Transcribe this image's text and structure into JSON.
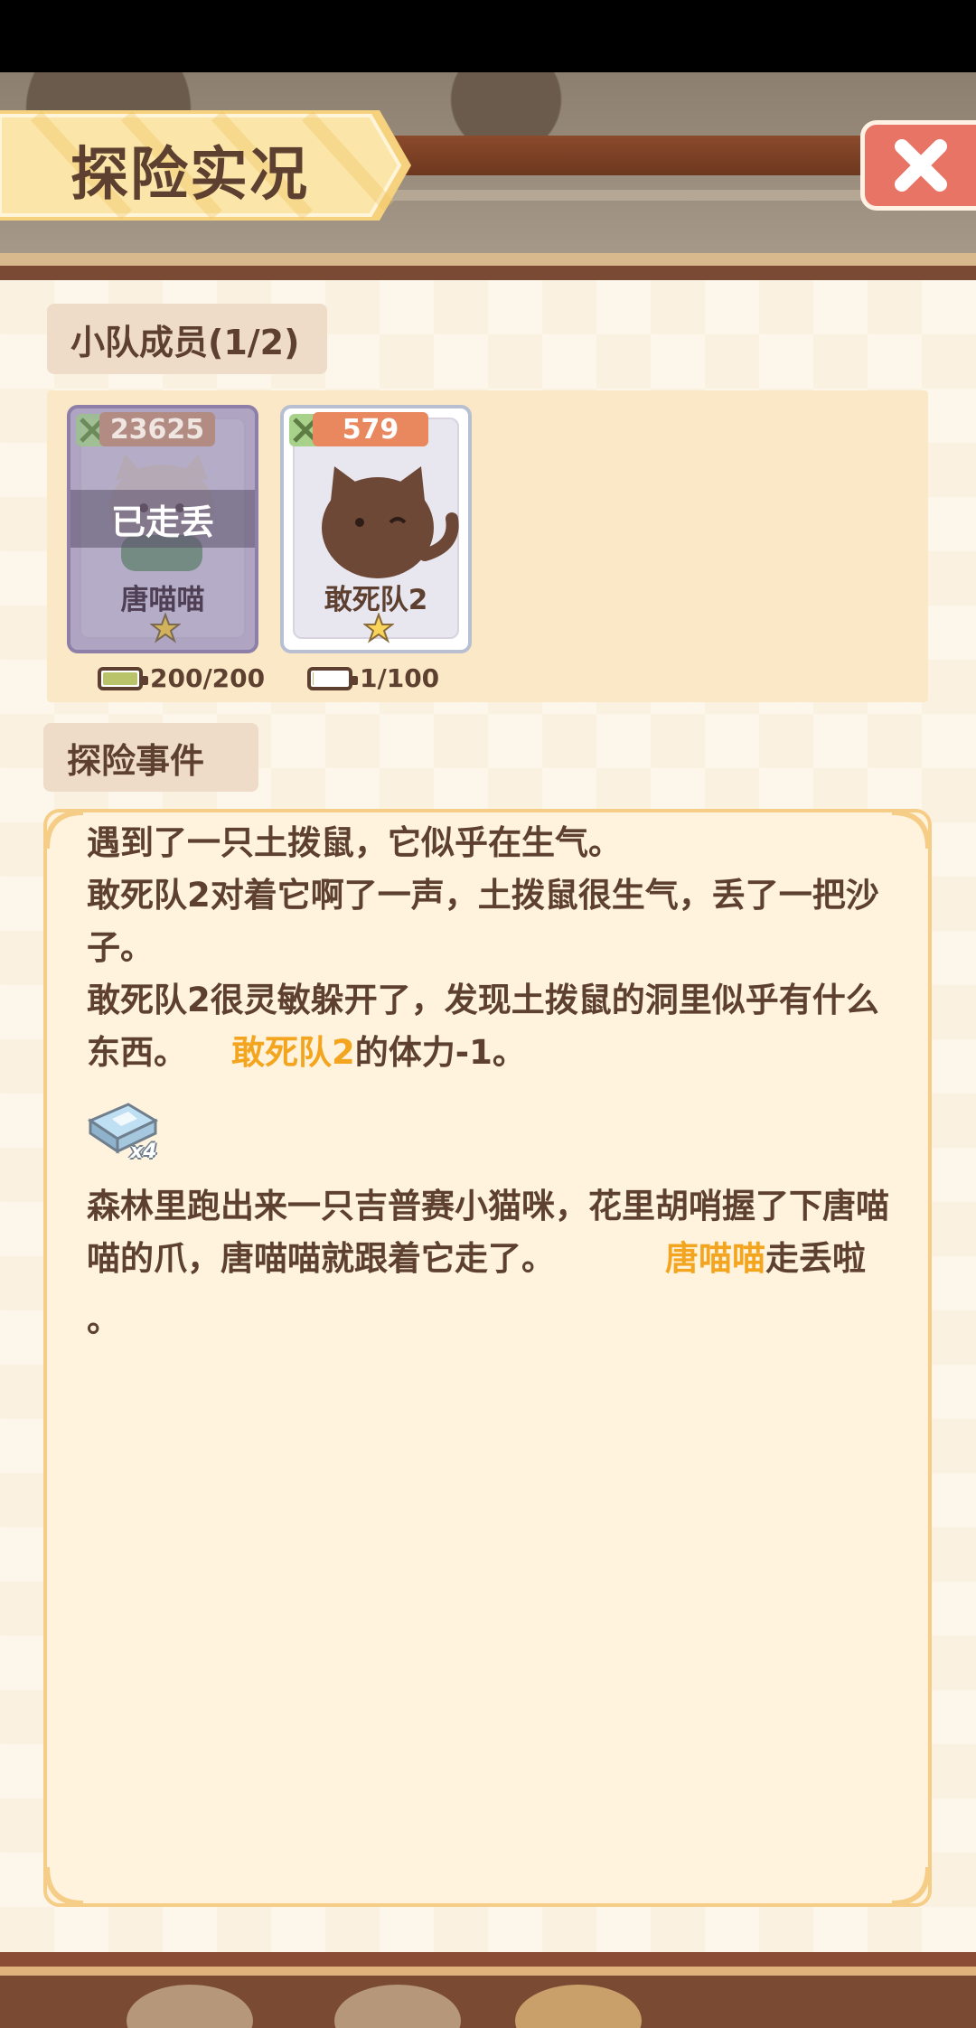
{
  "header": {
    "title": "探险实况"
  },
  "team": {
    "label": "小队成员(1/2)",
    "members": [
      {
        "name": "唐喵喵",
        "power": "23625",
        "status": "已走丢",
        "energy": "200/200",
        "energy_level": 1.0
      },
      {
        "name": "敢死队2",
        "power": "579",
        "status": "",
        "energy": "1/100",
        "energy_level": 0.01
      }
    ]
  },
  "events": {
    "label": "探险事件",
    "line1": "遇到了一只土拨鼠，它似乎在生气。",
    "line2": "敢死队2对着它啊了一声，土拨鼠很生气，丢了一把沙子。",
    "line3a": "敢死队2很灵敏躲开了，发现土拨鼠的洞里似乎有什么东西。",
    "line3_name": "敢死队2",
    "line3b": "的体力-1。",
    "reward_count": "x4",
    "line4a": "森林里跑出来一只吉普赛小猫咪，花里胡哨握了下唐喵喵的爪，唐喵喵就跟着它走了。",
    "line4_name": "唐喵喵",
    "line4b": "走丢啦",
    "line4c": "。"
  },
  "colors": {
    "accent": "#f4a51f",
    "text": "#5d4030",
    "close": "#e77465",
    "panel_border": "#f6cd86"
  },
  "icons": {
    "close": "close-icon",
    "power": "crossed-swords-icon",
    "star": "star-icon",
    "battery": "battery-icon",
    "item": "crystal-item-icon"
  }
}
